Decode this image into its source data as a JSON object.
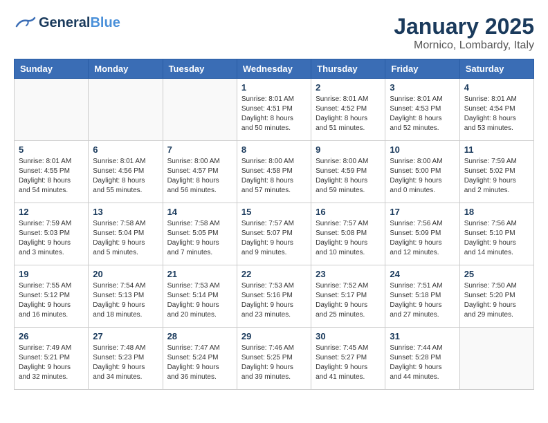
{
  "header": {
    "logo_general": "General",
    "logo_blue": "Blue",
    "month_title": "January 2025",
    "location": "Mornico, Lombardy, Italy"
  },
  "weekdays": [
    "Sunday",
    "Monday",
    "Tuesday",
    "Wednesday",
    "Thursday",
    "Friday",
    "Saturday"
  ],
  "weeks": [
    [
      {
        "day": "",
        "info": ""
      },
      {
        "day": "",
        "info": ""
      },
      {
        "day": "",
        "info": ""
      },
      {
        "day": "1",
        "info": "Sunrise: 8:01 AM\nSunset: 4:51 PM\nDaylight: 8 hours\nand 50 minutes."
      },
      {
        "day": "2",
        "info": "Sunrise: 8:01 AM\nSunset: 4:52 PM\nDaylight: 8 hours\nand 51 minutes."
      },
      {
        "day": "3",
        "info": "Sunrise: 8:01 AM\nSunset: 4:53 PM\nDaylight: 8 hours\nand 52 minutes."
      },
      {
        "day": "4",
        "info": "Sunrise: 8:01 AM\nSunset: 4:54 PM\nDaylight: 8 hours\nand 53 minutes."
      }
    ],
    [
      {
        "day": "5",
        "info": "Sunrise: 8:01 AM\nSunset: 4:55 PM\nDaylight: 8 hours\nand 54 minutes."
      },
      {
        "day": "6",
        "info": "Sunrise: 8:01 AM\nSunset: 4:56 PM\nDaylight: 8 hours\nand 55 minutes."
      },
      {
        "day": "7",
        "info": "Sunrise: 8:00 AM\nSunset: 4:57 PM\nDaylight: 8 hours\nand 56 minutes."
      },
      {
        "day": "8",
        "info": "Sunrise: 8:00 AM\nSunset: 4:58 PM\nDaylight: 8 hours\nand 57 minutes."
      },
      {
        "day": "9",
        "info": "Sunrise: 8:00 AM\nSunset: 4:59 PM\nDaylight: 8 hours\nand 59 minutes."
      },
      {
        "day": "10",
        "info": "Sunrise: 8:00 AM\nSunset: 5:00 PM\nDaylight: 9 hours\nand 0 minutes."
      },
      {
        "day": "11",
        "info": "Sunrise: 7:59 AM\nSunset: 5:02 PM\nDaylight: 9 hours\nand 2 minutes."
      }
    ],
    [
      {
        "day": "12",
        "info": "Sunrise: 7:59 AM\nSunset: 5:03 PM\nDaylight: 9 hours\nand 3 minutes."
      },
      {
        "day": "13",
        "info": "Sunrise: 7:58 AM\nSunset: 5:04 PM\nDaylight: 9 hours\nand 5 minutes."
      },
      {
        "day": "14",
        "info": "Sunrise: 7:58 AM\nSunset: 5:05 PM\nDaylight: 9 hours\nand 7 minutes."
      },
      {
        "day": "15",
        "info": "Sunrise: 7:57 AM\nSunset: 5:07 PM\nDaylight: 9 hours\nand 9 minutes."
      },
      {
        "day": "16",
        "info": "Sunrise: 7:57 AM\nSunset: 5:08 PM\nDaylight: 9 hours\nand 10 minutes."
      },
      {
        "day": "17",
        "info": "Sunrise: 7:56 AM\nSunset: 5:09 PM\nDaylight: 9 hours\nand 12 minutes."
      },
      {
        "day": "18",
        "info": "Sunrise: 7:56 AM\nSunset: 5:10 PM\nDaylight: 9 hours\nand 14 minutes."
      }
    ],
    [
      {
        "day": "19",
        "info": "Sunrise: 7:55 AM\nSunset: 5:12 PM\nDaylight: 9 hours\nand 16 minutes."
      },
      {
        "day": "20",
        "info": "Sunrise: 7:54 AM\nSunset: 5:13 PM\nDaylight: 9 hours\nand 18 minutes."
      },
      {
        "day": "21",
        "info": "Sunrise: 7:53 AM\nSunset: 5:14 PM\nDaylight: 9 hours\nand 20 minutes."
      },
      {
        "day": "22",
        "info": "Sunrise: 7:53 AM\nSunset: 5:16 PM\nDaylight: 9 hours\nand 23 minutes."
      },
      {
        "day": "23",
        "info": "Sunrise: 7:52 AM\nSunset: 5:17 PM\nDaylight: 9 hours\nand 25 minutes."
      },
      {
        "day": "24",
        "info": "Sunrise: 7:51 AM\nSunset: 5:18 PM\nDaylight: 9 hours\nand 27 minutes."
      },
      {
        "day": "25",
        "info": "Sunrise: 7:50 AM\nSunset: 5:20 PM\nDaylight: 9 hours\nand 29 minutes."
      }
    ],
    [
      {
        "day": "26",
        "info": "Sunrise: 7:49 AM\nSunset: 5:21 PM\nDaylight: 9 hours\nand 32 minutes."
      },
      {
        "day": "27",
        "info": "Sunrise: 7:48 AM\nSunset: 5:23 PM\nDaylight: 9 hours\nand 34 minutes."
      },
      {
        "day": "28",
        "info": "Sunrise: 7:47 AM\nSunset: 5:24 PM\nDaylight: 9 hours\nand 36 minutes."
      },
      {
        "day": "29",
        "info": "Sunrise: 7:46 AM\nSunset: 5:25 PM\nDaylight: 9 hours\nand 39 minutes."
      },
      {
        "day": "30",
        "info": "Sunrise: 7:45 AM\nSunset: 5:27 PM\nDaylight: 9 hours\nand 41 minutes."
      },
      {
        "day": "31",
        "info": "Sunrise: 7:44 AM\nSunset: 5:28 PM\nDaylight: 9 hours\nand 44 minutes."
      },
      {
        "day": "",
        "info": ""
      }
    ]
  ]
}
